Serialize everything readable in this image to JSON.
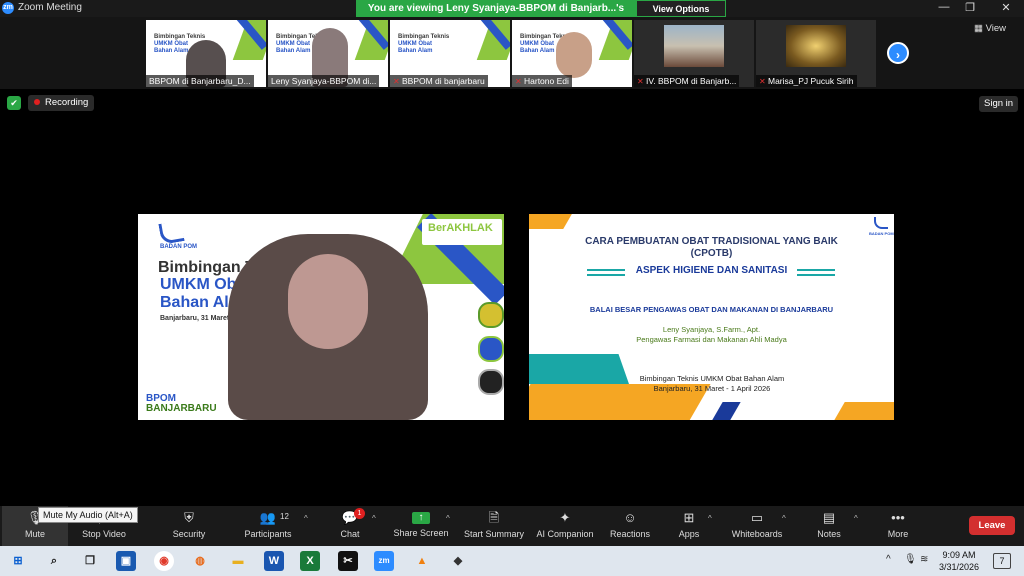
{
  "window": {
    "app_logo": "zm",
    "title": "Zoom Meeting",
    "share_banner": "You are viewing Leny Syanjaya-BBPOM  di Banjarb...'s screen",
    "view_options": "View Options",
    "controls": {
      "minimize": "—",
      "maximize": "❐",
      "close": "✕"
    }
  },
  "thumbnails": [
    {
      "name": "BBPOM di Banjarbaru_D...",
      "muted": false
    },
    {
      "name": "Leny Syanjaya-BBPOM  di...",
      "muted": false
    },
    {
      "name": "BBPOM di banjarbaru",
      "muted": true
    },
    {
      "name": "Hartono Edi",
      "muted": true
    },
    {
      "name": "IV. BBPOM di Banjarb...",
      "muted": true
    },
    {
      "name": "Marisa_PJ Pucuk Sirih",
      "muted": true
    }
  ],
  "thumb_slide": {
    "line1": "Bimbingan Teknis",
    "line2": "UMKM Obat",
    "line3": "Bahan Alam"
  },
  "view_button": "View",
  "recording_label": "Recording",
  "signin_label": "Sign in",
  "left_share": {
    "badan": "BADAN POM",
    "title1": "Bimbingan Te",
    "title2": "UMKM Obat",
    "title3": "Bahan Alam",
    "date": "Banjarbaru, 31 Maret-01 April 2",
    "akhlak": "BerAKHLAK",
    "bpom": "BPOM",
    "city": "BANJARBARU"
  },
  "right_share": {
    "badan": "BADAN POM",
    "title1": "CARA PEMBUATAN OBAT TRADISIONAL YANG BAIK",
    "title2": "(CPOTB)",
    "subtitle": "ASPEK HIGIENE DAN SANITASI",
    "org": "BALAI BESAR PENGAWAS OBAT DAN MAKANAN DI BANJARBARU",
    "name": "Leny Syanjaya, S.Farm., Apt.",
    "role": "Pengawas Farmasi dan Makanan Ahli Madya",
    "event1": "Bimbingan Teknis UMKM Obat Bahan Alam",
    "event2": "Banjarbaru, 31 Maret - 1 April 2026"
  },
  "tooltip": "Mute My Audio (Alt+A)",
  "toolbar": {
    "mute": "Mute",
    "stop_video": "Stop Video",
    "security": "Security",
    "participants": "Participants",
    "participants_count": "12",
    "chat": "Chat",
    "chat_badge": "1",
    "share_screen": "Share Screen",
    "start_summary": "Start Summary",
    "ai_companion": "AI Companion",
    "reactions": "Reactions",
    "apps": "Apps",
    "whiteboards": "Whiteboards",
    "notes": "Notes",
    "more": "More",
    "leave": "Leave"
  },
  "taskbar": {
    "time": "9:09 AM",
    "date": "3/31/2026",
    "notifications": "7"
  },
  "colors": {
    "zoom_blue": "#2d8cff",
    "share_green": "#2aa745",
    "leave_red": "#d32f2f"
  }
}
